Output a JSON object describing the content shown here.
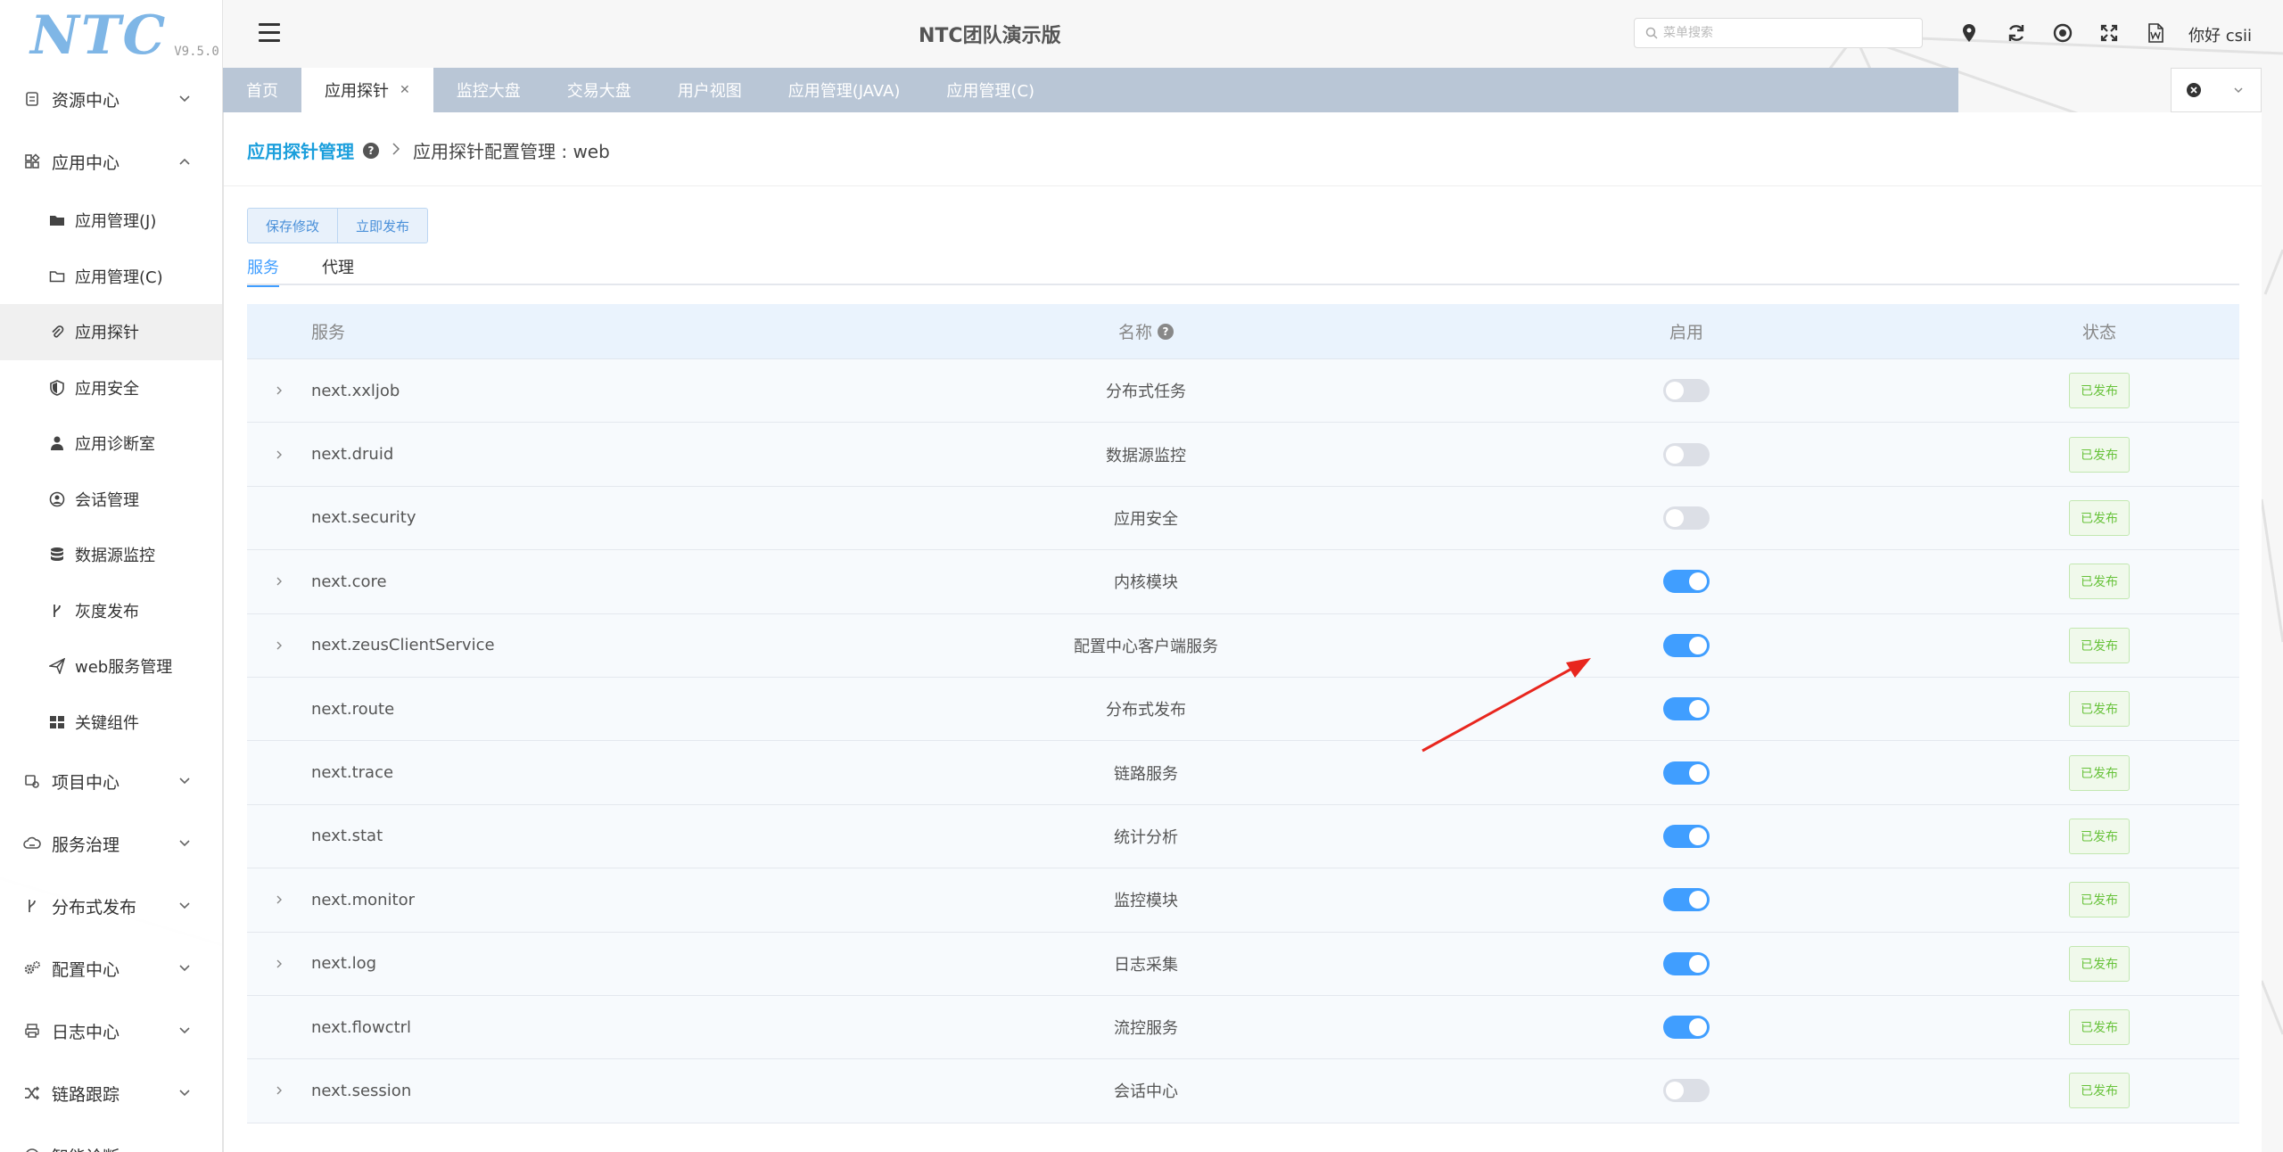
{
  "logo": {
    "text": "NTC",
    "version": "V9.5.0"
  },
  "sidebar": {
    "groups": [
      {
        "label": "资源中心",
        "expanded": false
      },
      {
        "label": "应用中心",
        "expanded": true
      },
      {
        "label": "项目中心",
        "expanded": false
      },
      {
        "label": "服务治理",
        "expanded": false
      },
      {
        "label": "分布式发布",
        "expanded": false
      },
      {
        "label": "配置中心",
        "expanded": false
      },
      {
        "label": "日志中心",
        "expanded": false
      },
      {
        "label": "链路跟踪",
        "expanded": false
      },
      {
        "label": "智能诊断",
        "expanded": false
      }
    ],
    "app_items": [
      {
        "label": "应用管理(J)",
        "icon": "folder-filled-icon"
      },
      {
        "label": "应用管理(C)",
        "icon": "folder-outline-icon"
      },
      {
        "label": "应用探针",
        "icon": "paperclip-icon",
        "active": true
      },
      {
        "label": "应用安全",
        "icon": "shield-icon"
      },
      {
        "label": "应用诊断室",
        "icon": "doctor-icon"
      },
      {
        "label": "会话管理",
        "icon": "user-circle-icon"
      },
      {
        "label": "数据源监控",
        "icon": "database-icon"
      },
      {
        "label": "灰度发布",
        "icon": "branch-icon"
      },
      {
        "label": "web服务管理",
        "icon": "send-icon"
      },
      {
        "label": "关键组件",
        "icon": "grid-icon"
      }
    ]
  },
  "header": {
    "title": "NTC团队演示版",
    "search_placeholder": "菜单搜索",
    "greeting": "你好 csii"
  },
  "tabs": [
    {
      "label": "首页",
      "active": false
    },
    {
      "label": "应用探针",
      "active": true,
      "closable": true
    },
    {
      "label": "监控大盘",
      "active": false
    },
    {
      "label": "交易大盘",
      "active": false
    },
    {
      "label": "用户视图",
      "active": false
    },
    {
      "label": "应用管理(JAVA)",
      "active": false
    },
    {
      "label": "应用管理(C)",
      "active": false
    }
  ],
  "breadcrumb": {
    "root": "应用探针管理",
    "current": "应用探针配置管理 : web"
  },
  "buttons": {
    "save": "保存修改",
    "publish": "立即发布"
  },
  "inner_tabs": [
    {
      "label": "服务",
      "active": true
    },
    {
      "label": "代理",
      "active": false
    }
  ],
  "table": {
    "headers": {
      "service": "服务",
      "name": "名称",
      "enabled": "启用",
      "status": "状态"
    },
    "rows": [
      {
        "service": "next.xxljob",
        "name": "分布式任务",
        "enabled": false,
        "status": "已发布",
        "expandable": true
      },
      {
        "service": "next.druid",
        "name": "数据源监控",
        "enabled": false,
        "status": "已发布",
        "expandable": true
      },
      {
        "service": "next.security",
        "name": "应用安全",
        "enabled": false,
        "status": "已发布",
        "expandable": false
      },
      {
        "service": "next.core",
        "name": "内核模块",
        "enabled": true,
        "status": "已发布",
        "expandable": true
      },
      {
        "service": "next.zeusClientService",
        "name": "配置中心客户端服务",
        "enabled": true,
        "status": "已发布",
        "expandable": true
      },
      {
        "service": "next.route",
        "name": "分布式发布",
        "enabled": true,
        "status": "已发布",
        "expandable": false
      },
      {
        "service": "next.trace",
        "name": "链路服务",
        "enabled": true,
        "status": "已发布",
        "expandable": false
      },
      {
        "service": "next.stat",
        "name": "统计分析",
        "enabled": true,
        "status": "已发布",
        "expandable": false
      },
      {
        "service": "next.monitor",
        "name": "监控模块",
        "enabled": true,
        "status": "已发布",
        "expandable": true
      },
      {
        "service": "next.log",
        "name": "日志采集",
        "enabled": true,
        "status": "已发布",
        "expandable": true
      },
      {
        "service": "next.flowctrl",
        "name": "流控服务",
        "enabled": true,
        "status": "已发布",
        "expandable": false
      },
      {
        "service": "next.session",
        "name": "会话中心",
        "enabled": false,
        "status": "已发布",
        "expandable": true
      }
    ]
  },
  "colors": {
    "accent": "#409eff",
    "brand_title": "#1c9fdc",
    "tabbar": "#b9c6d6",
    "success": "#67c23a",
    "annotation_arrow": "#e8261e"
  }
}
